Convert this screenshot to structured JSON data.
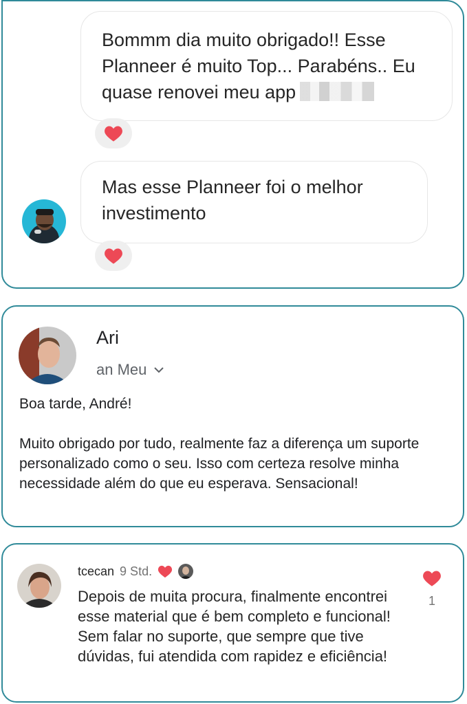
{
  "card1": {
    "message1": "Bommm dia muito obrigado!! Esse Planneer é muito Top... Parabéns.. Eu quase renovei meu app",
    "message2": "Mas esse Planneer foi o melhor investimento",
    "reaction_icon": "heart-icon"
  },
  "card2": {
    "sender": "Ari",
    "recipient": "an Meu",
    "greeting": "Boa tarde, André!",
    "body": "Muito obrigado por tudo, realmente faz a diferença um suporte personalizado como o seu. Isso com certeza resolve minha necessidade além do que eu esperava. Sensacional!"
  },
  "card3": {
    "username": "tcecan",
    "time": "9 Std.",
    "comment": "Depois de muita procura, finalmente encontrei esse material que é bem completo e funcional! Sem falar no suporte, que sempre que tive dúvidas, fui atendida com rapidez e eficiência!",
    "likes": "1"
  },
  "colors": {
    "border": "#2f8a99",
    "heart": "#ed4956",
    "reaction_bg": "#efefef"
  }
}
